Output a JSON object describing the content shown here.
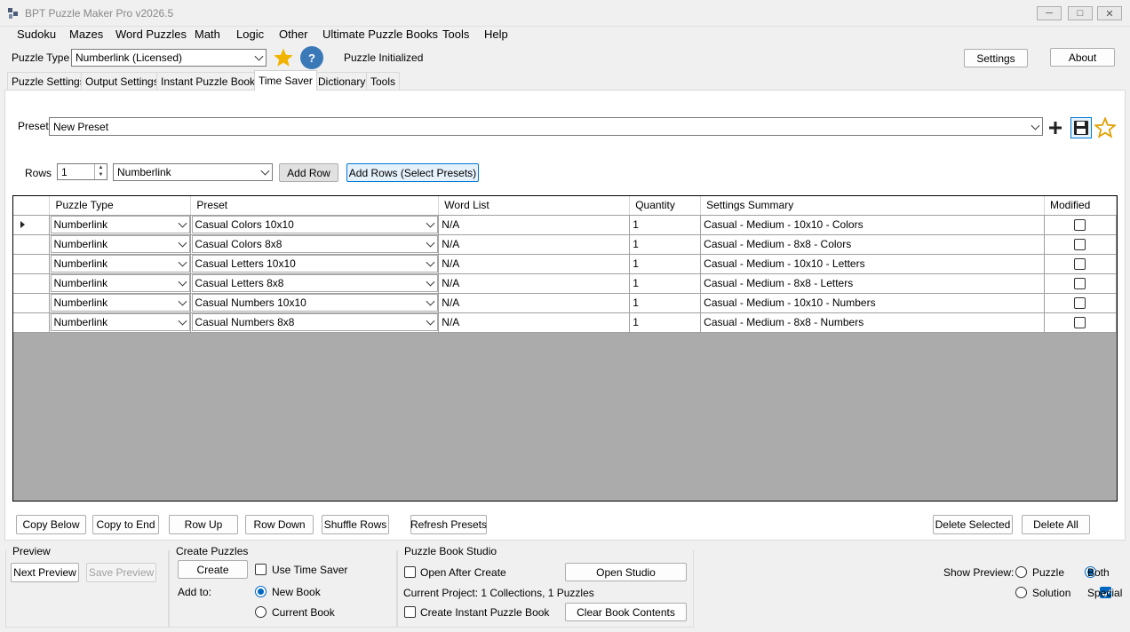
{
  "window": {
    "title": "BPT Puzzle Maker Pro v2026.5"
  },
  "menu": [
    "Sudoku",
    "Mazes",
    "Word Puzzles",
    "Math",
    "Logic",
    "Other",
    "Ultimate Puzzle Books",
    "Tools",
    "Help"
  ],
  "toolbar": {
    "puzzle_type_label": "Puzzle Type",
    "puzzle_type_value": "Numberlink (Licensed)",
    "status": "Puzzle Initialized",
    "settings_label": "Settings",
    "about_label": "About",
    "help_glyph": "?"
  },
  "tabs": [
    "Puzzle Settings",
    "Output Settings",
    "Instant Puzzle Books",
    "Time Saver",
    "Dictionary",
    "Tools"
  ],
  "active_tab": "Time Saver",
  "preset_bar": {
    "label": "Preset",
    "value": "New Preset"
  },
  "rows_bar": {
    "label": "Rows",
    "count": "1",
    "type_value": "Numberlink",
    "add_row": "Add Row",
    "add_rows_presets": "Add Rows (Select Presets)"
  },
  "grid": {
    "columns": [
      "Puzzle Type",
      "Preset",
      "Word List",
      "Quantity",
      "Settings Summary",
      "Modified"
    ],
    "rows": [
      {
        "type": "Numberlink",
        "preset": "Casual Colors 10x10",
        "word_list": "N/A",
        "quantity": "1",
        "summary": "Casual - Medium - 10x10 - Colors",
        "modified": false
      },
      {
        "type": "Numberlink",
        "preset": "Casual Colors 8x8",
        "word_list": "N/A",
        "quantity": "1",
        "summary": "Casual - Medium - 8x8 - Colors",
        "modified": false
      },
      {
        "type": "Numberlink",
        "preset": "Casual Letters 10x10",
        "word_list": "N/A",
        "quantity": "1",
        "summary": "Casual - Medium - 10x10 - Letters",
        "modified": false
      },
      {
        "type": "Numberlink",
        "preset": "Casual Letters 8x8",
        "word_list": "N/A",
        "quantity": "1",
        "summary": "Casual - Medium - 8x8 - Letters",
        "modified": false
      },
      {
        "type": "Numberlink",
        "preset": "Casual Numbers 10x10",
        "word_list": "N/A",
        "quantity": "1",
        "summary": "Casual - Medium - 10x10 - Numbers",
        "modified": false
      },
      {
        "type": "Numberlink",
        "preset": "Casual Numbers 8x8",
        "word_list": "N/A",
        "quantity": "1",
        "summary": "Casual - Medium - 8x8 - Numbers",
        "modified": false
      }
    ]
  },
  "grid_buttons": {
    "copy_below": "Copy Below",
    "copy_to_end": "Copy to End",
    "row_up": "Row Up",
    "row_down": "Row Down",
    "shuffle_rows": "Shuffle Rows",
    "refresh_presets": "Refresh Presets",
    "delete_selected": "Delete Selected",
    "delete_all": "Delete All"
  },
  "preview_group": {
    "title": "Preview",
    "next": "Next Preview",
    "save": "Save Preview"
  },
  "create_group": {
    "title": "Create Puzzles",
    "create": "Create",
    "use_time_saver": "Use Time Saver",
    "add_to": "Add to:",
    "new_book": "New Book",
    "current_book": "Current Book"
  },
  "studio_group": {
    "title": "Puzzle Book Studio",
    "open_after_create": "Open After Create",
    "open_studio": "Open Studio",
    "current_project": "Current Project: 1 Collections, 1 Puzzles",
    "create_instant_book": "Create Instant Puzzle Book",
    "clear_book_contents": "Clear Book Contents"
  },
  "show_preview": {
    "label": "Show Preview:",
    "puzzle": "Puzzle",
    "both": "Both",
    "solution": "Solution",
    "special": "Special"
  },
  "colors": {
    "accent": "#0078d7",
    "star": "#f0b400",
    "help_circle": "#3b78b8",
    "grid_bg": "#ababab"
  }
}
